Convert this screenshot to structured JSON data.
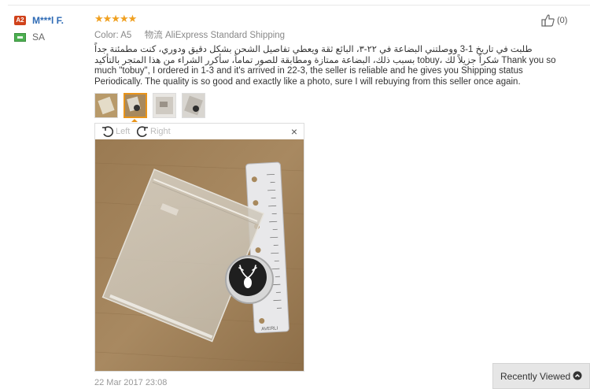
{
  "buyer": {
    "badge": "A2",
    "name": "M***l F.",
    "country": "SA"
  },
  "review": {
    "rating": 5,
    "stars": "★★★★★",
    "color_label": "Color:",
    "color_value": "A5",
    "shipping_label": "物流",
    "shipping_value": "AliExpress Standard Shipping",
    "text": "طلبت في تاريخ 1-3 ووصلتني البضاعة في ٢٢-٣، البائع ثقة ويعطي تفاصيل الشحن بشكل دقيق ودوري، كنت مطمئنة جداً بسبب ذلك، البضاعة ممتازة ومطابقة للصور تماماً، سأكرر الشراء من هذا المتجر بالتأكيد tobuy، شكراً جزيلاً لك Thank you so much \"tobuy\", I ordered in 1-3 and it's arrived in 22-3, the seller is reliable and he gives you Shipping status Periodically. The quality is so good and exactly like a photo, sure I will rebuying from this seller once again.",
    "date": "22 Mar 2017 23:08",
    "helpful_count": "(0)"
  },
  "viewer": {
    "rotate_left": "Left",
    "rotate_right": "Right",
    "close": "×",
    "ruler_text": "AVERLI"
  },
  "thumbnails": [
    "photo-1",
    "photo-2",
    "photo-3",
    "photo-4"
  ],
  "active_thumbnail": 1,
  "recently_viewed": {
    "label": "Recently Viewed"
  },
  "colors": {
    "accent_orange": "#e8941a",
    "star": "#f0a020",
    "name_blue": "#2f6bb5",
    "badge_red": "#d0421b"
  }
}
